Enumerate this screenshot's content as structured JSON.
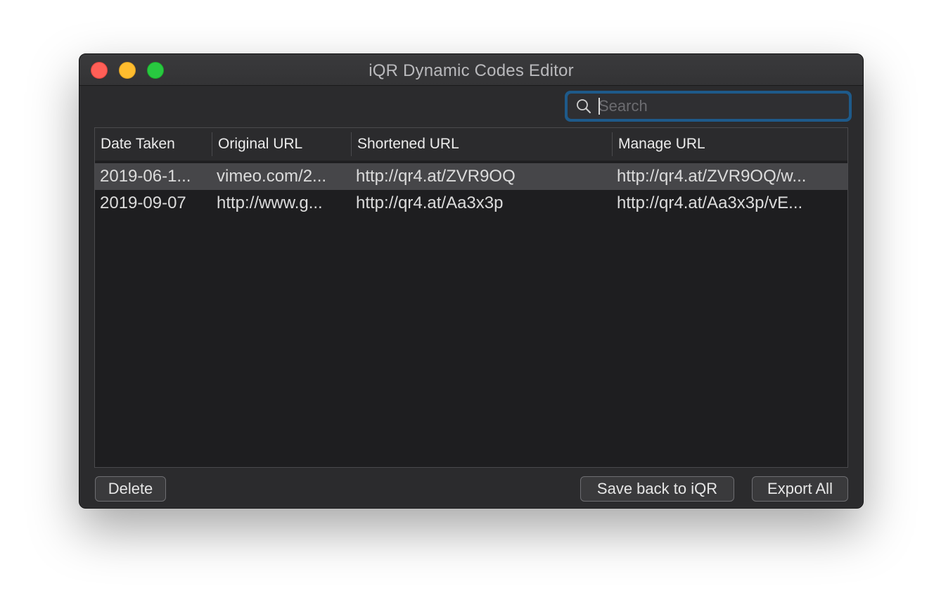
{
  "window": {
    "title": "iQR Dynamic Codes Editor"
  },
  "search": {
    "placeholder": "Search",
    "value": ""
  },
  "table": {
    "columns": [
      "Date Taken",
      "Original URL",
      "Shortened URL",
      "Manage URL"
    ],
    "rows": [
      {
        "date": "2019-06-1...",
        "original": "vimeo.com/2...",
        "shortened": "http://qr4.at/ZVR9OQ",
        "manage": "http://qr4.at/ZVR9OQ/w...",
        "selected": true
      },
      {
        "date": "2019-09-07",
        "original": "http://www.g...",
        "shortened": "http://qr4.at/Aa3x3p",
        "manage": "http://qr4.at/Aa3x3p/vE...",
        "selected": false
      }
    ]
  },
  "buttons": {
    "delete": "Delete",
    "save_back": "Save back to iQR",
    "export_all": "Export All"
  },
  "colors": {
    "close": "#ff5f57",
    "minimize": "#febc2e",
    "zoom": "#28c840",
    "focus_ring": "#1e5a8a"
  },
  "icons": {
    "search": "magnifying-glass"
  }
}
